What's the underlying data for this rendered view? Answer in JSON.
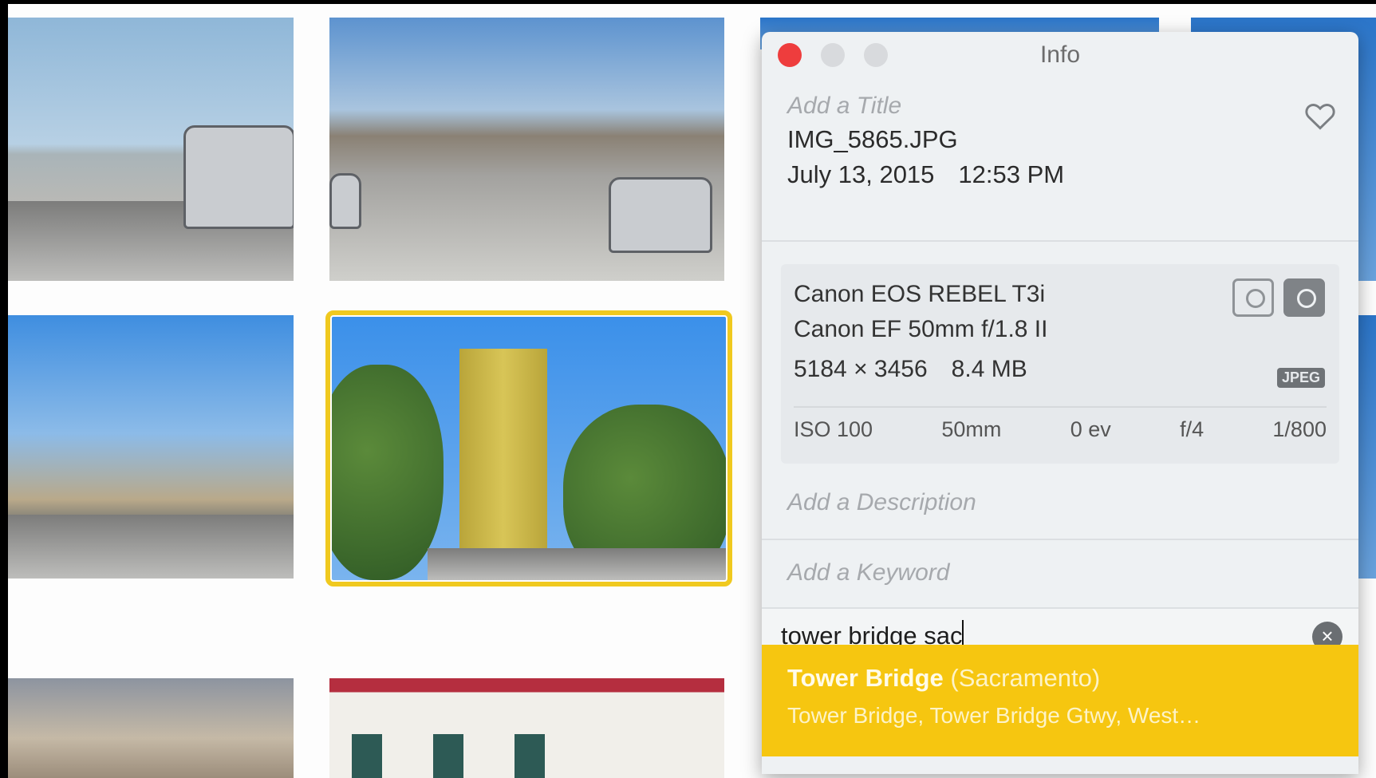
{
  "panel": {
    "window_title": "Info",
    "title_placeholder": "Add a Title",
    "filename": "IMG_5865.JPG",
    "date": "July 13, 2015",
    "time": "12:53 PM",
    "favorite_icon": "heart-icon"
  },
  "camera": {
    "model": "Canon EOS REBEL T3i",
    "lens": "Canon EF 50mm f/1.8 II",
    "dimensions": "5184 × 3456",
    "file_size": "8.4 MB",
    "format_badge": "JPEG",
    "exif": {
      "iso": "ISO 100",
      "focal_length": "50mm",
      "exposure": "0 ev",
      "aperture": "f/4",
      "shutter": "1/800"
    }
  },
  "description": {
    "placeholder": "Add a Description"
  },
  "keywords": {
    "placeholder": "Add a Keyword",
    "input_value": "tower bridge sac"
  },
  "suggestion": {
    "name": "Tower Bridge",
    "qualifier": "(Sacramento)",
    "subtitle": "Tower Bridge, Tower Bridge Gtwy, West…"
  },
  "colors": {
    "selection": "#f0c91f",
    "suggestion_bg": "#f6c610",
    "close_button": "#ee3d3d"
  }
}
